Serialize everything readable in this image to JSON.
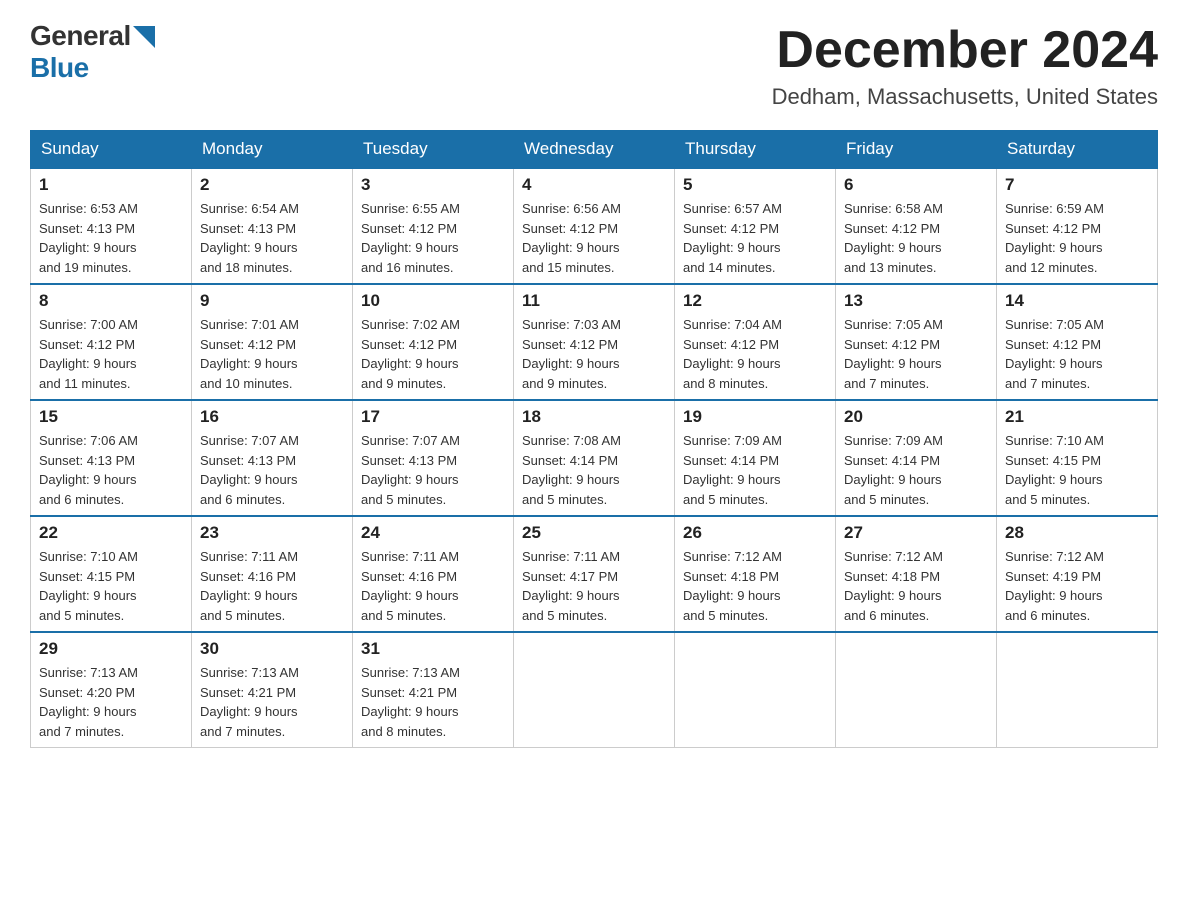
{
  "header": {
    "logo_general": "General",
    "logo_blue": "Blue",
    "month_title": "December 2024",
    "location": "Dedham, Massachusetts, United States"
  },
  "weekdays": [
    "Sunday",
    "Monday",
    "Tuesday",
    "Wednesday",
    "Thursday",
    "Friday",
    "Saturday"
  ],
  "weeks": [
    [
      {
        "day": "1",
        "sunrise": "6:53 AM",
        "sunset": "4:13 PM",
        "daylight": "9 hours and 19 minutes."
      },
      {
        "day": "2",
        "sunrise": "6:54 AM",
        "sunset": "4:13 PM",
        "daylight": "9 hours and 18 minutes."
      },
      {
        "day": "3",
        "sunrise": "6:55 AM",
        "sunset": "4:12 PM",
        "daylight": "9 hours and 16 minutes."
      },
      {
        "day": "4",
        "sunrise": "6:56 AM",
        "sunset": "4:12 PM",
        "daylight": "9 hours and 15 minutes."
      },
      {
        "day": "5",
        "sunrise": "6:57 AM",
        "sunset": "4:12 PM",
        "daylight": "9 hours and 14 minutes."
      },
      {
        "day": "6",
        "sunrise": "6:58 AM",
        "sunset": "4:12 PM",
        "daylight": "9 hours and 13 minutes."
      },
      {
        "day": "7",
        "sunrise": "6:59 AM",
        "sunset": "4:12 PM",
        "daylight": "9 hours and 12 minutes."
      }
    ],
    [
      {
        "day": "8",
        "sunrise": "7:00 AM",
        "sunset": "4:12 PM",
        "daylight": "9 hours and 11 minutes."
      },
      {
        "day": "9",
        "sunrise": "7:01 AM",
        "sunset": "4:12 PM",
        "daylight": "9 hours and 10 minutes."
      },
      {
        "day": "10",
        "sunrise": "7:02 AM",
        "sunset": "4:12 PM",
        "daylight": "9 hours and 9 minutes."
      },
      {
        "day": "11",
        "sunrise": "7:03 AM",
        "sunset": "4:12 PM",
        "daylight": "9 hours and 9 minutes."
      },
      {
        "day": "12",
        "sunrise": "7:04 AM",
        "sunset": "4:12 PM",
        "daylight": "9 hours and 8 minutes."
      },
      {
        "day": "13",
        "sunrise": "7:05 AM",
        "sunset": "4:12 PM",
        "daylight": "9 hours and 7 minutes."
      },
      {
        "day": "14",
        "sunrise": "7:05 AM",
        "sunset": "4:12 PM",
        "daylight": "9 hours and 7 minutes."
      }
    ],
    [
      {
        "day": "15",
        "sunrise": "7:06 AM",
        "sunset": "4:13 PM",
        "daylight": "9 hours and 6 minutes."
      },
      {
        "day": "16",
        "sunrise": "7:07 AM",
        "sunset": "4:13 PM",
        "daylight": "9 hours and 6 minutes."
      },
      {
        "day": "17",
        "sunrise": "7:07 AM",
        "sunset": "4:13 PM",
        "daylight": "9 hours and 5 minutes."
      },
      {
        "day": "18",
        "sunrise": "7:08 AM",
        "sunset": "4:14 PM",
        "daylight": "9 hours and 5 minutes."
      },
      {
        "day": "19",
        "sunrise": "7:09 AM",
        "sunset": "4:14 PM",
        "daylight": "9 hours and 5 minutes."
      },
      {
        "day": "20",
        "sunrise": "7:09 AM",
        "sunset": "4:14 PM",
        "daylight": "9 hours and 5 minutes."
      },
      {
        "day": "21",
        "sunrise": "7:10 AM",
        "sunset": "4:15 PM",
        "daylight": "9 hours and 5 minutes."
      }
    ],
    [
      {
        "day": "22",
        "sunrise": "7:10 AM",
        "sunset": "4:15 PM",
        "daylight": "9 hours and 5 minutes."
      },
      {
        "day": "23",
        "sunrise": "7:11 AM",
        "sunset": "4:16 PM",
        "daylight": "9 hours and 5 minutes."
      },
      {
        "day": "24",
        "sunrise": "7:11 AM",
        "sunset": "4:16 PM",
        "daylight": "9 hours and 5 minutes."
      },
      {
        "day": "25",
        "sunrise": "7:11 AM",
        "sunset": "4:17 PM",
        "daylight": "9 hours and 5 minutes."
      },
      {
        "day": "26",
        "sunrise": "7:12 AM",
        "sunset": "4:18 PM",
        "daylight": "9 hours and 5 minutes."
      },
      {
        "day": "27",
        "sunrise": "7:12 AM",
        "sunset": "4:18 PM",
        "daylight": "9 hours and 6 minutes."
      },
      {
        "day": "28",
        "sunrise": "7:12 AM",
        "sunset": "4:19 PM",
        "daylight": "9 hours and 6 minutes."
      }
    ],
    [
      {
        "day": "29",
        "sunrise": "7:13 AM",
        "sunset": "4:20 PM",
        "daylight": "9 hours and 7 minutes."
      },
      {
        "day": "30",
        "sunrise": "7:13 AM",
        "sunset": "4:21 PM",
        "daylight": "9 hours and 7 minutes."
      },
      {
        "day": "31",
        "sunrise": "7:13 AM",
        "sunset": "4:21 PM",
        "daylight": "9 hours and 8 minutes."
      },
      null,
      null,
      null,
      null
    ]
  ]
}
